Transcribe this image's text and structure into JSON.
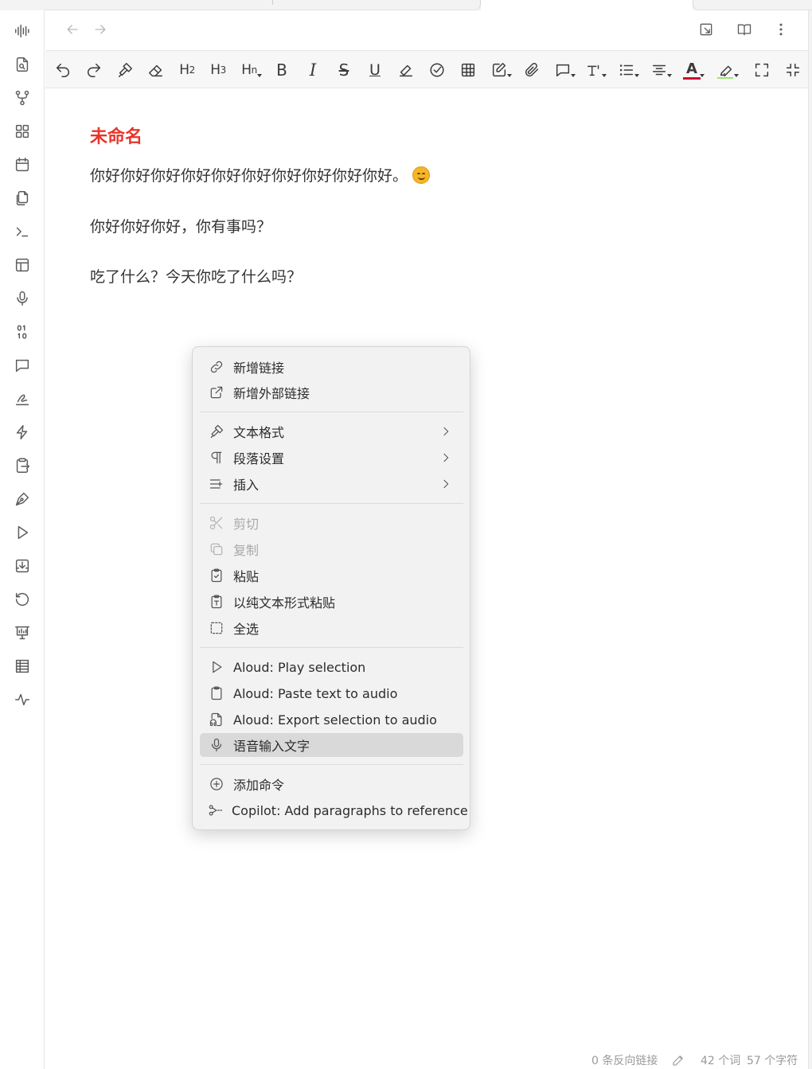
{
  "nav": {
    "back_icon": "arrow-left-icon",
    "forward_icon": "arrow-right-icon",
    "right_icons": [
      "open-in-new-window-icon",
      "book-open-icon",
      "more-vertical-icon"
    ]
  },
  "ribbon": {
    "icons": [
      "audio-waveform-icon",
      "file-search-icon",
      "git-fork-icon",
      "layout-grid-icon",
      "calendar-icon",
      "copy-files-icon",
      "terminal-icon",
      "layout-template-icon",
      "microphone-icon",
      "binary-icon",
      "message-square-icon",
      "signature-icon",
      "lightning-icon",
      "file-export-icon",
      "pen-tool-icon",
      "play-icon",
      "download-box-icon",
      "history-icon",
      "presentation-chart-icon",
      "table-icon",
      "activity-icon"
    ]
  },
  "toolbar": {
    "h2": "H",
    "h2_sub": "2",
    "h3": "H",
    "h3_sub": "3",
    "hn": "H",
    "hn_sub": "n",
    "bold": "B",
    "italic": "I",
    "strike": "S",
    "underline": "U",
    "font_color_letter": "A",
    "font_color": "#c8102e",
    "highlight_color": "#9be27f"
  },
  "document": {
    "title": "未命名",
    "paragraphs": [
      "你好你好你好你好你好你好你好你好你好你好。",
      "你好你好你好，你有事吗？",
      "吃了什么？今天你吃了什么吗？"
    ]
  },
  "context_menu": {
    "groups": [
      [
        {
          "label": "新增链接",
          "icon": "link-icon",
          "disabled": false,
          "submenu": false
        },
        {
          "label": "新增外部链接",
          "icon": "external-link-icon",
          "disabled": false,
          "submenu": false
        }
      ],
      [
        {
          "label": "文本格式",
          "icon": "paint-brush-icon",
          "disabled": false,
          "submenu": true
        },
        {
          "label": "段落设置",
          "icon": "pilcrow-icon",
          "disabled": false,
          "submenu": true
        },
        {
          "label": "插入",
          "icon": "list-plus-icon",
          "disabled": false,
          "submenu": true
        }
      ],
      [
        {
          "label": "剪切",
          "icon": "scissors-icon",
          "disabled": true,
          "submenu": false
        },
        {
          "label": "复制",
          "icon": "copy-icon",
          "disabled": true,
          "submenu": false
        },
        {
          "label": "粘贴",
          "icon": "clipboard-check-icon",
          "disabled": false,
          "submenu": false
        },
        {
          "label": "以纯文本形式粘贴",
          "icon": "clipboard-type-icon",
          "disabled": false,
          "submenu": false
        },
        {
          "label": "全选",
          "icon": "select-all-icon",
          "disabled": false,
          "submenu": false
        }
      ],
      [
        {
          "label": "Aloud: Play selection",
          "icon": "play-icon",
          "disabled": false,
          "submenu": false
        },
        {
          "label": "Aloud: Paste text to audio",
          "icon": "clipboard-icon",
          "disabled": false,
          "submenu": false
        },
        {
          "label": "Aloud: Export selection to audio",
          "icon": "file-audio-icon",
          "disabled": false,
          "submenu": false
        },
        {
          "label": "语音输入文字",
          "icon": "microphone-icon",
          "disabled": false,
          "submenu": false,
          "highlighted": true
        }
      ],
      [
        {
          "label": "添加命令",
          "icon": "plus-circle-icon",
          "disabled": false,
          "submenu": false
        },
        {
          "label": "Copilot: Add paragraphs to reference",
          "icon": "scissors-dashed-icon",
          "disabled": false,
          "submenu": false
        }
      ]
    ]
  },
  "status": {
    "backlinks": "0 条反向链接",
    "words": "42 个词",
    "chars": "57 个字符"
  }
}
